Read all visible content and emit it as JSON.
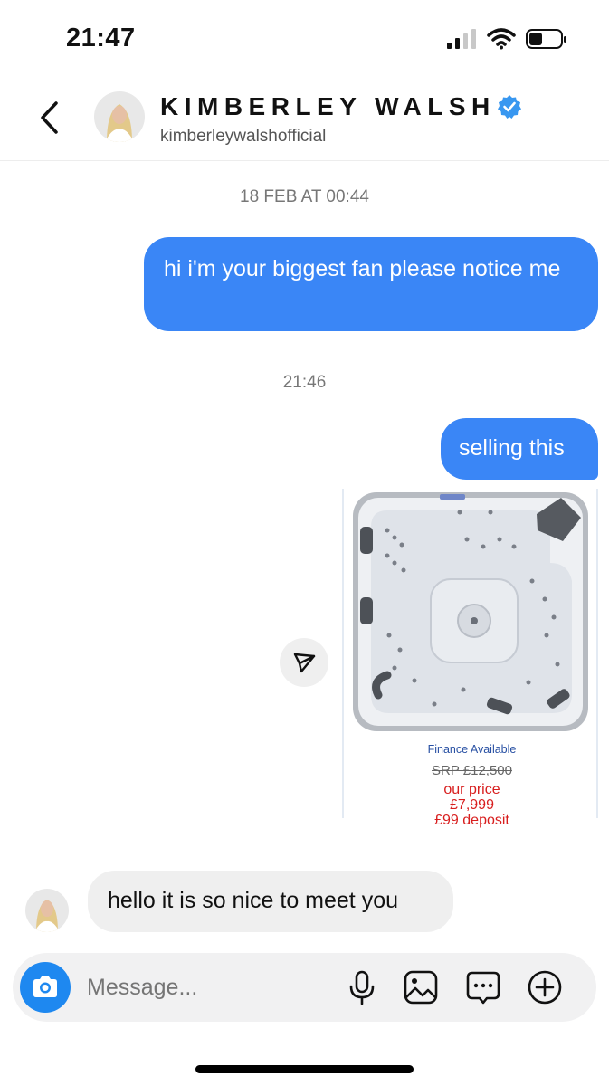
{
  "status_bar": {
    "time": "21:47"
  },
  "header": {
    "name": "KIMBERLEY WALSH",
    "handle": "kimberleywalshofficial"
  },
  "conversation": {
    "timestamp_1": "18 FEB AT 00:44",
    "message_1": "hi i'm your biggest fan please notice me",
    "timestamp_2": "21:46",
    "message_2": "selling this",
    "product_card": {
      "finance": "Finance Available",
      "srp": "SRP £12,500",
      "our_price_label": "our price",
      "price": "£7,999",
      "deposit": "£99 deposit"
    },
    "reply": "hello it is so nice to meet you"
  },
  "composer": {
    "placeholder": "Message..."
  },
  "colors": {
    "accent": "#3a86f6",
    "camera": "#1e88f0",
    "price_red": "#d81e1e",
    "verified": "#3897f0"
  }
}
